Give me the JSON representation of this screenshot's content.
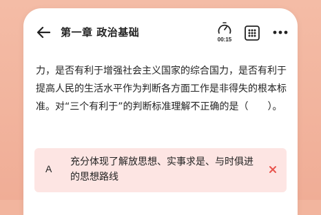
{
  "header": {
    "title": "第一章 政治基础",
    "timer": "00:15"
  },
  "question": {
    "text": "力，是否有利于增强社会主义国家的综合国力，是否有利于提高人民的生活水平作为判断各方面工作是非得失的根本标准。对“三个有利于”的判断标准理解不正确的是（　　）。"
  },
  "options": [
    {
      "letter": "A",
      "text": "充分体现了解放思想、实事求是、与时俱进的思想路线",
      "status": "wrong"
    }
  ],
  "colors": {
    "background": "#f2b59e",
    "option_wrong_bg": "#fde5e3",
    "wrong_mark": "#e8534c"
  }
}
